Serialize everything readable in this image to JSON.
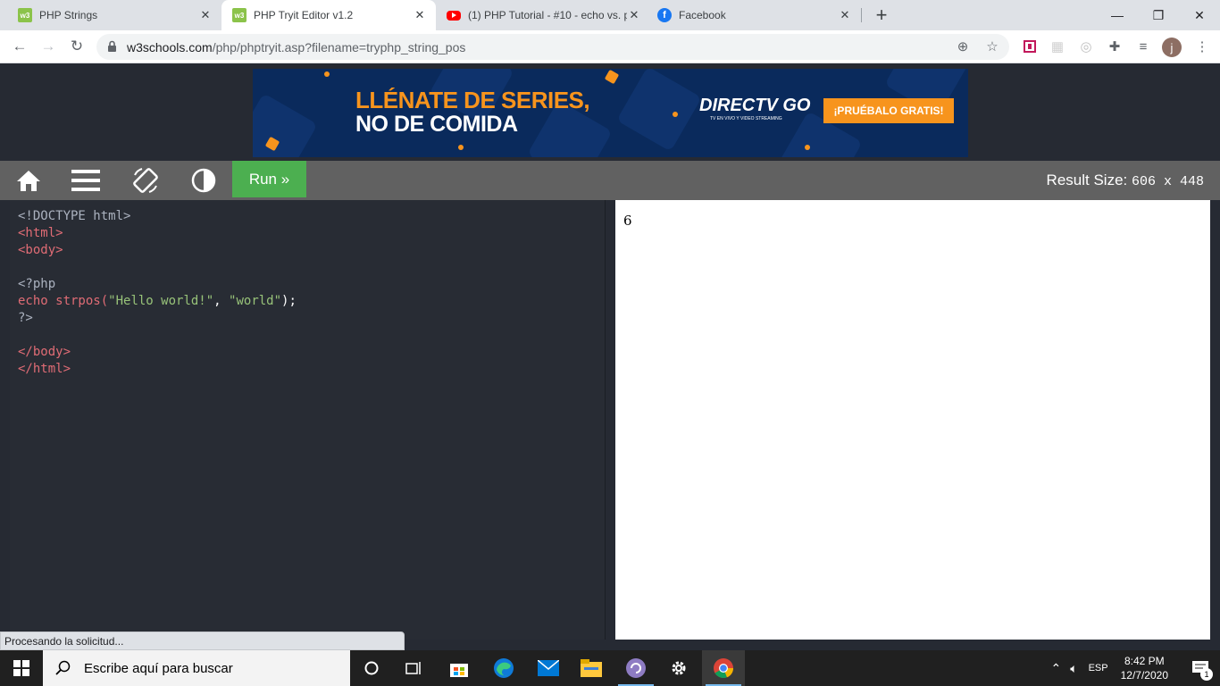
{
  "tabs": [
    {
      "title": "PHP Strings",
      "icon": "w3schools-favicon",
      "active": false
    },
    {
      "title": "PHP Tryit Editor v1.2",
      "icon": "w3schools-favicon",
      "active": true
    },
    {
      "title": "(1) PHP Tutorial - #10 - echo vs. p",
      "icon": "youtube-favicon",
      "active": false
    },
    {
      "title": "Facebook",
      "icon": "facebook-favicon",
      "active": false
    }
  ],
  "favicon_text": {
    "w3": "w3",
    "fb": "f"
  },
  "window_controls": {
    "minimize": "—",
    "maximize": "❐",
    "close": "✕"
  },
  "new_tab": "+",
  "address": {
    "host": "w3schools.com",
    "path": "/php/phptryit.asp?filename=tryphp_string_pos"
  },
  "ad": {
    "headline_1": "LLÉNATE DE SERIES,",
    "headline_2": "NO DE COMIDA",
    "brand": "DIRECTV GO",
    "brand_sub": "TV EN VIVO Y VIDEO STREAMING",
    "cta": "¡PRUÉBALO GRATIS!",
    "colors": {
      "orange": "#f7941d",
      "navy": "#0a2a5c"
    }
  },
  "editor": {
    "run_label": "Run »",
    "result_size_label": "Result Size:",
    "result_size_value": "606 x 448",
    "code_lines": {
      "l1": "<!DOCTYPE html>",
      "l2": "<html>",
      "l3": "<body>",
      "l5": "<?php",
      "l6_fn": "echo strpos(",
      "l6_a1": "\"Hello world!\"",
      "l6_sep": ", ",
      "l6_a2": "\"world\"",
      "l6_end": ");",
      "l7": "?>",
      "l9": "</body>",
      "l10": "</html>"
    },
    "colors": {
      "run": "#4caf50",
      "bar": "#616161",
      "code_bg": "#282c34",
      "tag": "#e06c75",
      "string": "#98c379"
    }
  },
  "result_output": "6",
  "status_text": "Procesando la solicitud...",
  "taskbar": {
    "search_placeholder": "Escribe aquí para buscar",
    "language": "ESP",
    "time": "8:42 PM",
    "date": "12/7/2020",
    "notification_count": "1"
  }
}
